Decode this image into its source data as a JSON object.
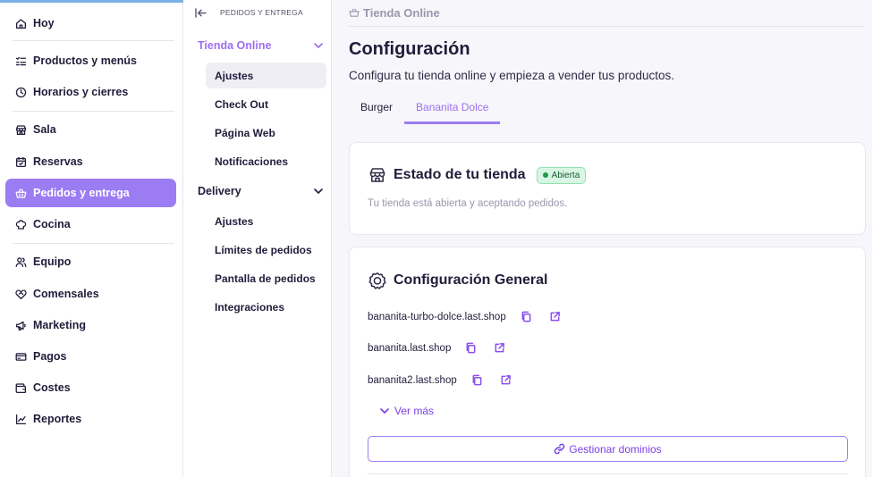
{
  "nav": {
    "items": [
      {
        "label": "Hoy",
        "icon": "home-icon"
      },
      {
        "label": "Productos y menús",
        "icon": "list-check-icon"
      },
      {
        "label": "Horarios y cierres",
        "icon": "clock-icon"
      },
      {
        "label": "Sala",
        "icon": "store-icon"
      },
      {
        "label": "Reservas",
        "icon": "calendar-check-icon"
      },
      {
        "label": "Pedidos y entrega",
        "icon": "basket-icon",
        "active": true
      },
      {
        "label": "Cocina",
        "icon": "chef-hat-icon"
      },
      {
        "label": "Equipo",
        "icon": "users-icon"
      },
      {
        "label": "Comensales",
        "icon": "heart-handshake-icon"
      },
      {
        "label": "Marketing",
        "icon": "megaphone-icon"
      },
      {
        "label": "Pagos",
        "icon": "credit-card-icon"
      },
      {
        "label": "Costes",
        "icon": "wallet-icon"
      },
      {
        "label": "Reportes",
        "icon": "chart-line-icon"
      }
    ]
  },
  "subnav": {
    "header": "PEDIDOS Y ENTREGA",
    "groups": [
      {
        "title": "Tienda Online",
        "items": [
          "Ajustes",
          "Check Out",
          "Página Web",
          "Notificaciones"
        ]
      },
      {
        "title": "Delivery",
        "items": [
          "Ajustes",
          "Límites de pedidos",
          "Pantalla de pedidos",
          "Integraciones"
        ]
      }
    ]
  },
  "main": {
    "breadcrumb": "Tienda Online",
    "title": "Configuración",
    "subtitle": "Configura tu tienda online y empieza a vender tus productos.",
    "tabs": [
      {
        "label": "Burger"
      },
      {
        "label": "Bananita Dolce",
        "active": true
      }
    ],
    "status_card": {
      "title": "Estado de tu tienda",
      "badge": "Abierta",
      "description": "Tu tienda está abierta y aceptando pedidos."
    },
    "general_card": {
      "title": "Configuración General",
      "domains": [
        "bananita-turbo-dolce.last.shop",
        "bananita.last.shop",
        "bananita2.last.shop"
      ],
      "show_more": "Ver más",
      "manage_button": "Gestionar dominios"
    }
  },
  "colors": {
    "accent": "#9c7cf2",
    "accent_text": "#7a3fe6",
    "status_green": "#1f9b52"
  }
}
